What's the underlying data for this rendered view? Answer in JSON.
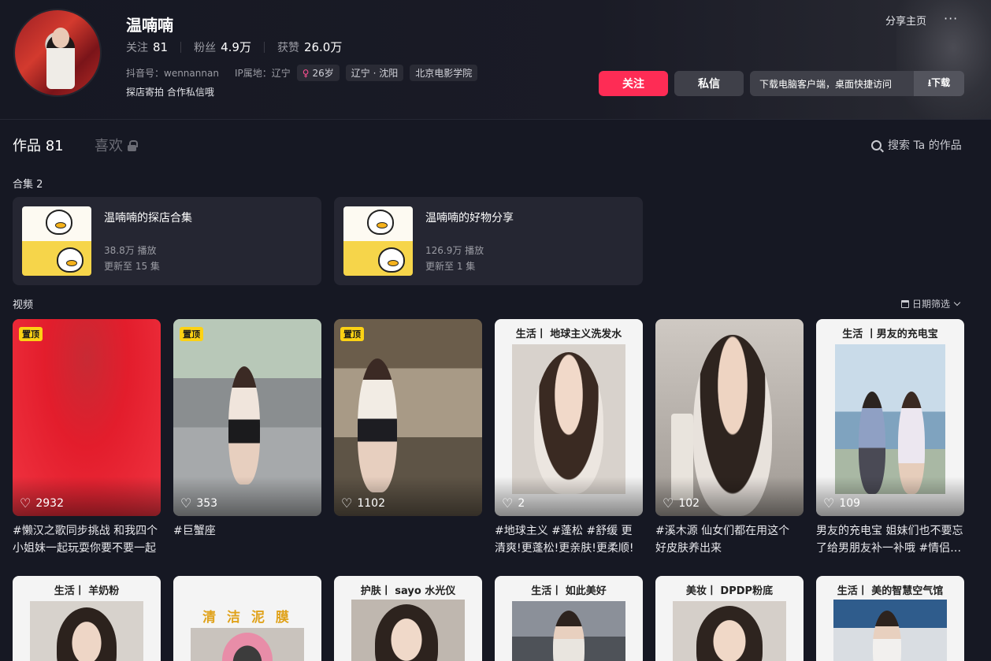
{
  "profile": {
    "nickname": "温喃喃",
    "following_label": "关注",
    "following": "81",
    "followers_label": "粉丝",
    "followers": "4.9万",
    "likes_label": "获赞",
    "likes": "26.0万",
    "douyin_id": "抖音号：wennannan",
    "ip_location": "IP属地：辽宁",
    "age_tag": "26岁",
    "location_tag": "辽宁 · 沈阳",
    "school_tag": "北京电影学院",
    "bio": "探店寄拍 合作私信哦",
    "share_label": "分享主页",
    "more_label": "···",
    "follow_button": "关注",
    "message_button": "私信",
    "download_hint": "下载电脑客户端，桌面快捷访问",
    "download_button": "⭳下载"
  },
  "tabs": {
    "works_label": "作品 81",
    "likes_label": "喜欢",
    "search_label": "搜索 Ta 的作品"
  },
  "collections": {
    "heading": "合集 2",
    "items": [
      {
        "title": "温喃喃的探店合集",
        "plays": "38.8万 播放",
        "episodes": "更新至 15 集"
      },
      {
        "title": "温喃喃的好物分享",
        "plays": "126.9万 播放",
        "episodes": "更新至 1 集"
      }
    ]
  },
  "videos": {
    "heading": "视频",
    "date_filter": "日期筛选",
    "pin_label": "置顶",
    "heart_icon": "♡",
    "items": [
      {
        "likes": "2932",
        "desc": "#懒汉之歌同步挑战 和我四个小姐妹一起玩耍你要不要一起",
        "pinned": true
      },
      {
        "likes": "353",
        "desc": "#巨蟹座",
        "pinned": true
      },
      {
        "likes": "1102",
        "desc": "",
        "pinned": true
      },
      {
        "likes": "2",
        "desc": "#地球主义 #蓬松 #舒缓 更清爽!更蓬松!更亲肤!更柔顺!",
        "frame_title": "生活丨 地球主义洗发水"
      },
      {
        "likes": "102",
        "desc": "#溪木源 仙女们都在用这个 好皮肤养出来"
      },
      {
        "likes": "109",
        "desc": "男友的充电宝 姐妹们也不要忘了给男朋友补一补哦 #情侣…",
        "frame_title": "生活 丨男友的充电宝"
      }
    ],
    "row2": [
      {
        "frame_title": "生活丨 羊奶粉"
      },
      {
        "frame_title": "清 洁 泥 膜"
      },
      {
        "frame_title": "护肤丨 sayo 水光仪"
      },
      {
        "frame_title": "生活丨 如此美好"
      },
      {
        "frame_title": "美妆丨 DPDP粉底"
      },
      {
        "frame_title": "生活丨 美的智慧空气馆"
      }
    ]
  }
}
